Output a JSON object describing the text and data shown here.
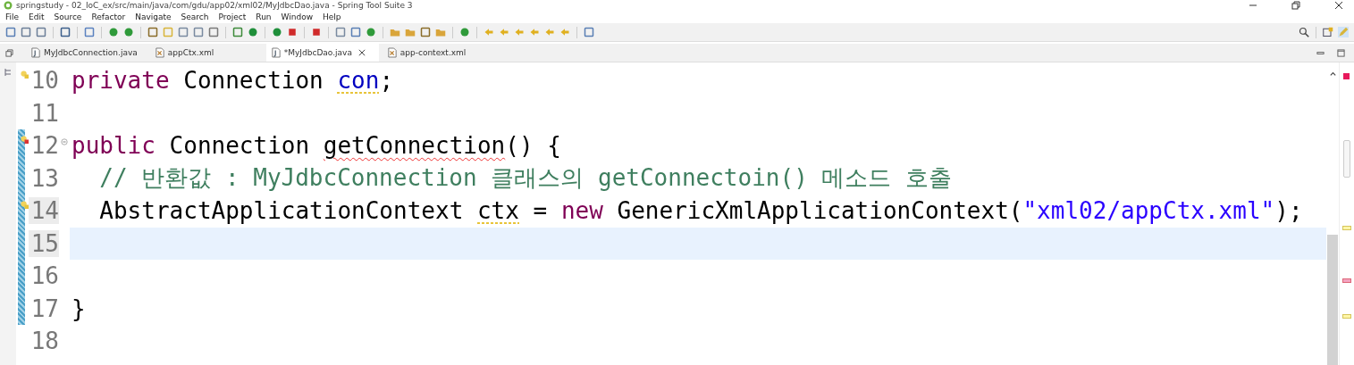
{
  "window": {
    "title": "springstudy - 02_IoC_ex/src/main/java/com/gdu/app02/xml02/MyJdbcDao.java - Spring Tool Suite 3"
  },
  "menu": [
    "File",
    "Edit",
    "Source",
    "Refactor",
    "Navigate",
    "Search",
    "Project",
    "Run",
    "Window",
    "Help"
  ],
  "tabs": [
    {
      "label": "MyJdbcConnection.java",
      "kind": "java",
      "selected": false,
      "closable": false
    },
    {
      "label": "appCtx.xml",
      "kind": "xml",
      "selected": false,
      "closable": false
    },
    {
      "label": "*MyJdbcDao.java",
      "kind": "java",
      "selected": true,
      "closable": true
    },
    {
      "label": "app-context.xml",
      "kind": "xml",
      "selected": false,
      "closable": false
    }
  ],
  "editor": {
    "lines": [
      {
        "number": "10",
        "warning_marker": true,
        "error_marker": false,
        "foldable": false,
        "current": false,
        "tokens": [
          {
            "kind": "keyword",
            "text": "private",
            "warning_underline": false,
            "error_underline": false
          },
          {
            "kind": "plain",
            "text": " Connection ",
            "warning_underline": false,
            "error_underline": false
          },
          {
            "kind": "field",
            "text": "con",
            "warning_underline": true,
            "error_underline": false
          },
          {
            "kind": "plain",
            "text": ";",
            "warning_underline": false,
            "error_underline": false
          }
        ]
      },
      {
        "number": "11",
        "warning_marker": false,
        "error_marker": false,
        "foldable": false,
        "current": false
      },
      {
        "number": "12",
        "warning_marker": false,
        "error_marker": true,
        "foldable": true,
        "current": false,
        "tokens": [
          {
            "kind": "keyword",
            "text": "public",
            "warning_underline": false,
            "error_underline": false
          },
          {
            "kind": "plain",
            "text": " Connection ",
            "warning_underline": false,
            "error_underline": false
          },
          {
            "kind": "plain",
            "text": "getConnection",
            "warning_underline": false,
            "error_underline": true
          },
          {
            "kind": "plain",
            "text": "() {",
            "warning_underline": false,
            "error_underline": false
          }
        ]
      },
      {
        "number": "13",
        "warning_marker": false,
        "error_marker": false,
        "foldable": false,
        "current": false,
        "tokens": [
          {
            "kind": "comment",
            "text": "  // 반환값 : MyJdbcConnection 클래스의 getConnectoin() 메소드 호출",
            "warning_underline": false,
            "error_underline": false
          }
        ]
      },
      {
        "number": "14",
        "warning_marker": true,
        "error_marker": false,
        "foldable": false,
        "current": false,
        "tokens": [
          {
            "kind": "plain",
            "text": "  AbstractApplicationContext ",
            "warning_underline": false,
            "error_underline": false
          },
          {
            "kind": "plain",
            "text": "ctx",
            "warning_underline": true,
            "error_underline": false
          },
          {
            "kind": "plain",
            "text": " = ",
            "warning_underline": false,
            "error_underline": false
          },
          {
            "kind": "keyword",
            "text": "new",
            "warning_underline": false,
            "error_underline": false
          },
          {
            "kind": "plain",
            "text": " GenericXmlApplicationContext(",
            "warning_underline": false,
            "error_underline": false
          },
          {
            "kind": "string",
            "text": "\"xml02/appCtx.xml\"",
            "warning_underline": false,
            "error_underline": false
          },
          {
            "kind": "plain",
            "text": ");",
            "warning_underline": false,
            "error_underline": false
          }
        ]
      },
      {
        "number": "15",
        "warning_marker": false,
        "error_marker": false,
        "foldable": false,
        "current": true
      },
      {
        "number": "16",
        "warning_marker": false,
        "error_marker": false,
        "foldable": false,
        "current": false
      },
      {
        "number": "17",
        "warning_marker": false,
        "error_marker": false,
        "foldable": false,
        "current": false,
        "tokens": [
          {
            "kind": "plain",
            "text": "}",
            "warning_underline": false,
            "error_underline": false
          }
        ]
      },
      {
        "number": "18",
        "warning_marker": false,
        "error_marker": false,
        "foldable": false,
        "current": false
      }
    ]
  }
}
